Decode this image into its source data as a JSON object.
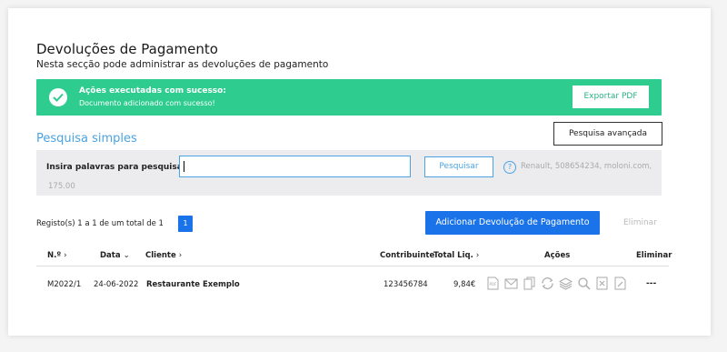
{
  "header": {
    "title": "Devoluções de Pagamento",
    "subtitle": "Nesta secção pode administrar as devoluções de pagamento"
  },
  "alert": {
    "title": "Ações executadas com sucesso:",
    "message": "Documento adicionado com sucesso!",
    "export_label": "Exportar PDF",
    "color": "#2ecc8f"
  },
  "search": {
    "title": "Pesquisa simples",
    "advanced_label": "Pesquisa avançada",
    "input_label": "Insira palavras para pesquisar",
    "input_value": "",
    "button_label": "Pesquisar",
    "help_symbol": "?",
    "hint_line1": "Renault, 508654234, moloni.com,",
    "hint_line2": "175.00"
  },
  "listing": {
    "records_text": "Registo(s) 1 a 1 de um total de 1",
    "current_page": "1",
    "add_label": "Adicionar Devolução de Pagamento",
    "delete_label": "Eliminar",
    "accent_color": "#1a73e8"
  },
  "table": {
    "headers": {
      "number": "N.º",
      "date": "Data",
      "client": "Cliente",
      "taxpayer": "Contribuinte",
      "total": "Total Liq.",
      "actions": "Ações",
      "delete": "Eliminar"
    },
    "rows": [
      {
        "number": "M2022/1",
        "date": "24-06-2022",
        "client": "Restaurante Exemplo",
        "taxpayer": "123456784",
        "total": "9,84€",
        "delete": "---"
      }
    ],
    "action_icons": [
      "pdf-icon",
      "email-icon",
      "copy-icon",
      "convert-icon",
      "layers-icon",
      "search-icon",
      "cancel-document-icon",
      "edit-document-icon"
    ]
  }
}
